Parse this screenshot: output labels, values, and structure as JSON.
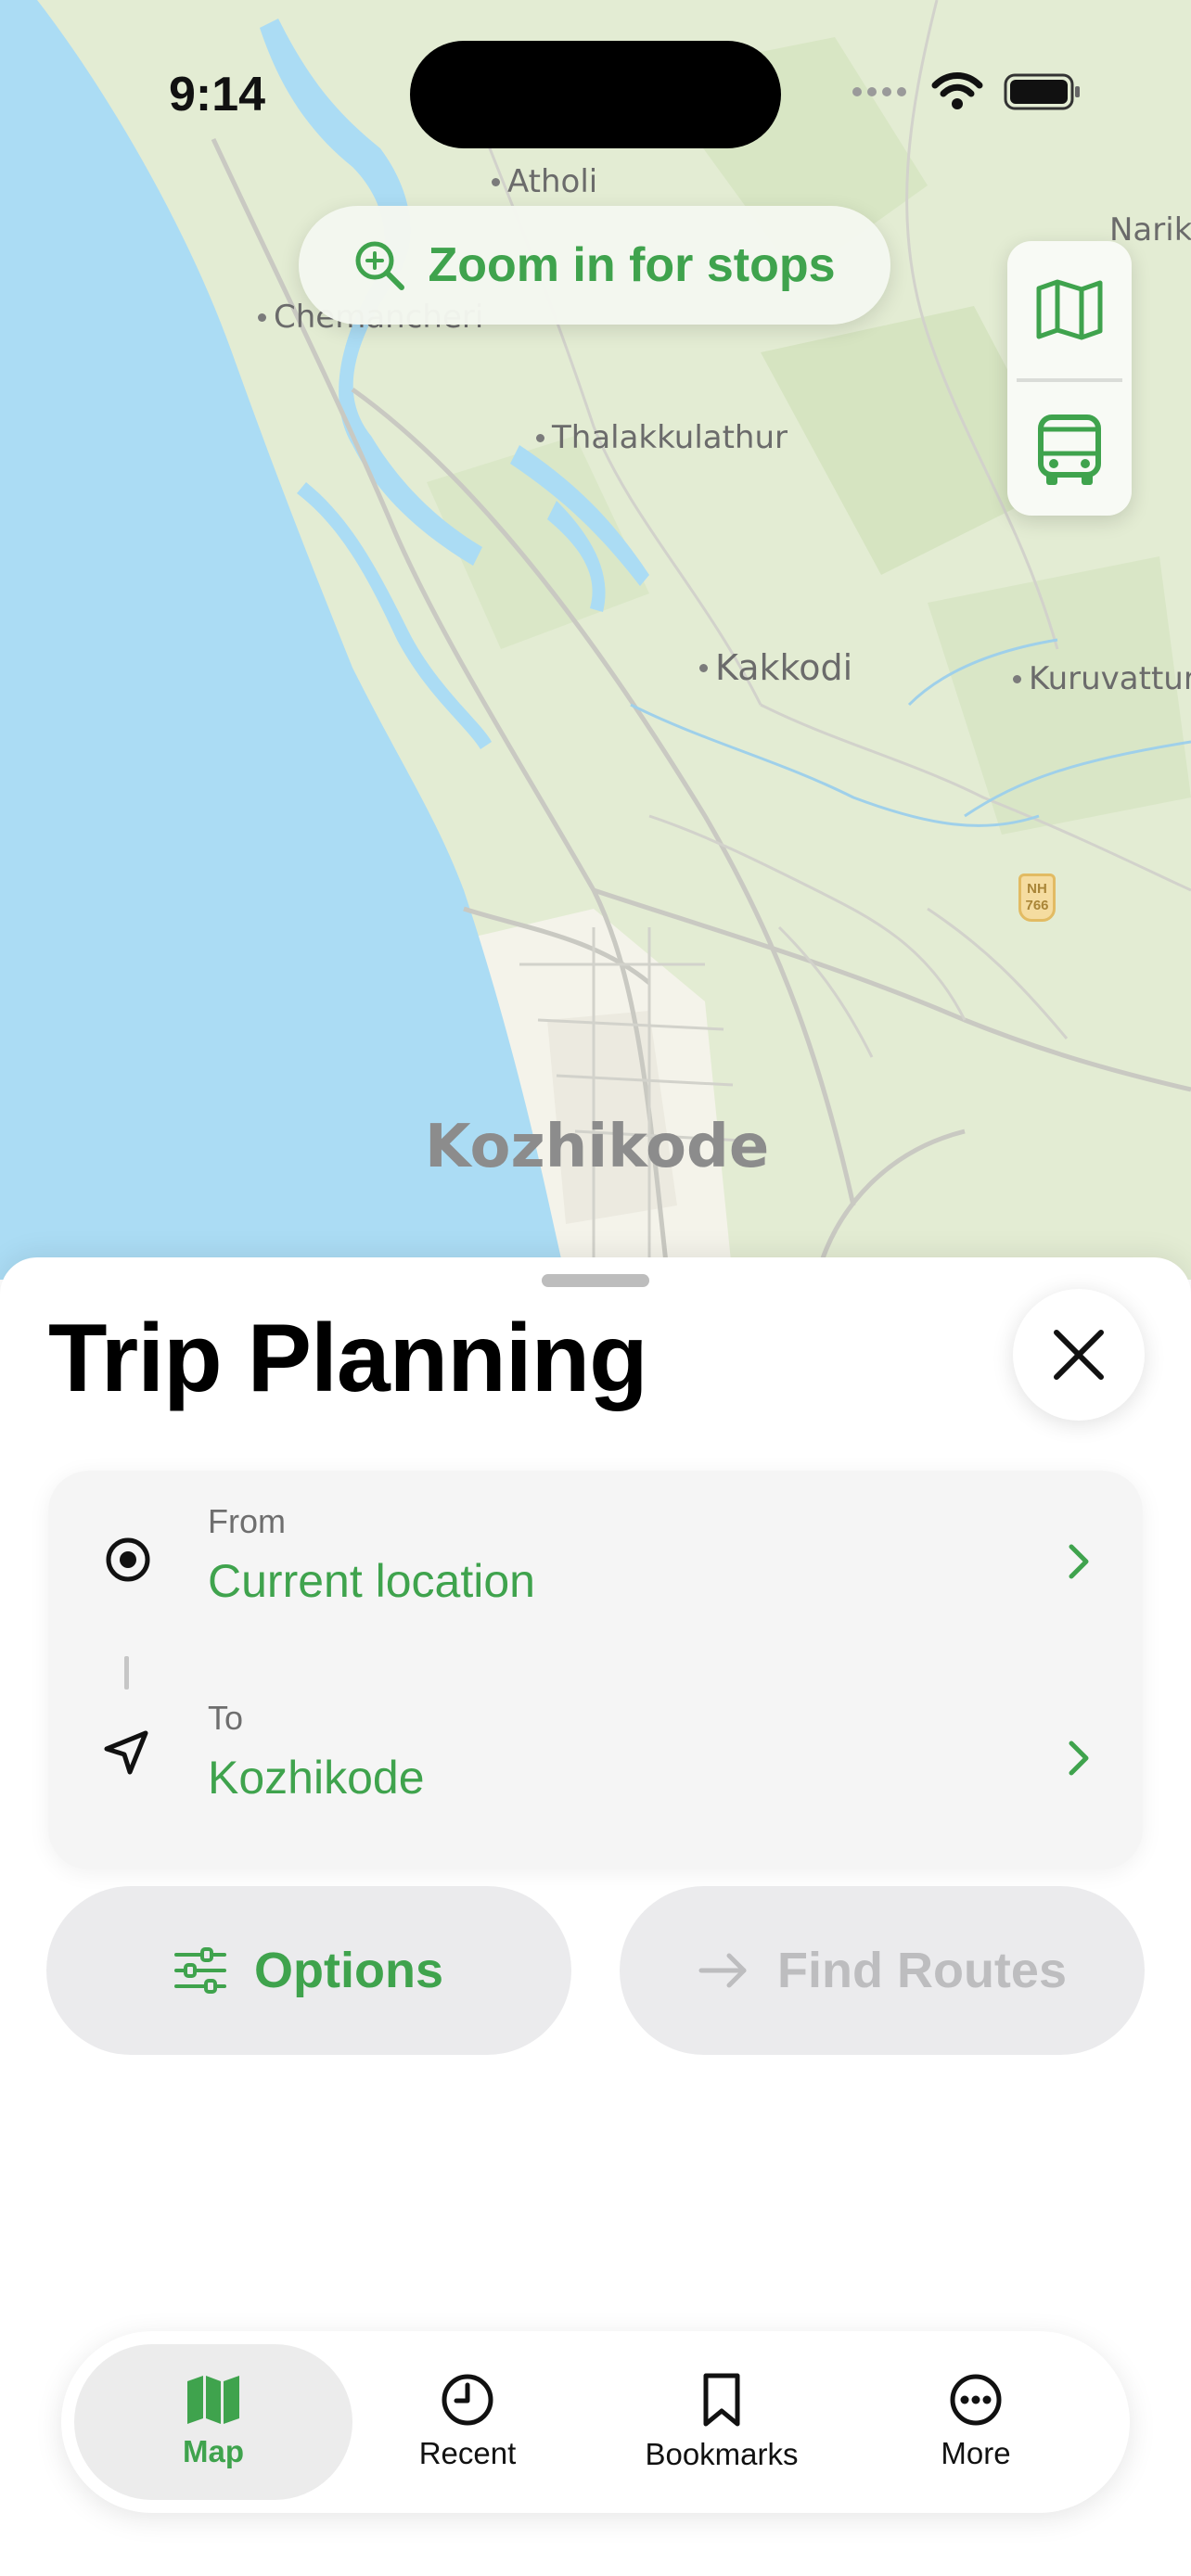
{
  "status_bar": {
    "time": "9:14"
  },
  "map": {
    "places": [
      {
        "name": "Atholi"
      },
      {
        "name": "Chemancheri"
      },
      {
        "name": "Narikkuni"
      },
      {
        "name": "Thalakkulathur"
      },
      {
        "name": "Kakkodi"
      },
      {
        "name": "Kuruvattur"
      }
    ],
    "city": "Kozhikode",
    "highway_shield": {
      "line1": "NH",
      "line2": "766"
    },
    "zoom_hint": "Zoom in for stops",
    "controls": {
      "map_icon": "map-icon",
      "transit_icon": "bus-icon"
    }
  },
  "sheet": {
    "title": "Trip Planning",
    "from": {
      "label": "From",
      "value": "Current location"
    },
    "to": {
      "label": "To",
      "value": "Kozhikode"
    },
    "options_button": "Options",
    "find_routes_button": "Find Routes"
  },
  "tabs": [
    {
      "label": "Map",
      "icon": "map-icon",
      "active": true
    },
    {
      "label": "Recent",
      "icon": "clock-icon",
      "active": false
    },
    {
      "label": "Bookmarks",
      "icon": "bookmark-icon",
      "active": false
    },
    {
      "label": "More",
      "icon": "more-icon",
      "active": false
    }
  ],
  "colors": {
    "accent": "#3fa34d",
    "sea": "#abdcf4",
    "land": "#e3ecd3",
    "disabled_text": "#bdbdbf"
  }
}
